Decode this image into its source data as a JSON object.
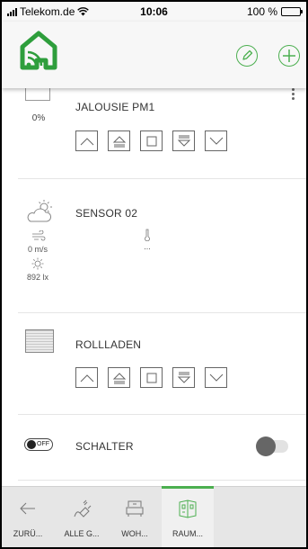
{
  "status_bar": {
    "carrier": "Telekom.de",
    "time": "10:06",
    "battery": "100 %",
    "battery_level": 1.0
  },
  "colors": {
    "accent": "#4caf50",
    "header_bg": "#f7f7f7",
    "nav_bg": "#e6e6e6"
  },
  "header": {
    "logo_icon": "smart-home-logo-icon",
    "edit_icon": "pencil-icon",
    "add_icon": "plus-icon"
  },
  "devices": [
    {
      "title": "JALOUSIE PM1",
      "value": "0%",
      "icon": "jalousie-icon",
      "controls": [
        "up-icon",
        "up-limit-icon",
        "stop-icon",
        "down-limit-icon",
        "down-icon"
      ]
    },
    {
      "title": "SENSOR 02",
      "icon": "weather-icon",
      "wind_value": "0 m/s",
      "temp_value": "...",
      "lux_value": "892 lx"
    },
    {
      "title": "ROLLLADEN",
      "icon": "rollladen-icon",
      "controls": [
        "up-icon",
        "up-limit-icon",
        "stop-icon",
        "down-limit-icon",
        "down-icon"
      ]
    },
    {
      "title": "SCHALTER",
      "icon": "switch-off-icon",
      "badge": "OFF",
      "state": "off"
    }
  ],
  "bottom_nav": [
    {
      "label": "ZURÜ...",
      "icon": "back-arrow-icon",
      "active": false
    },
    {
      "label": "ALLE G...",
      "icon": "plug-icon",
      "active": false
    },
    {
      "label": "WOH...",
      "icon": "sofa-icon",
      "active": false
    },
    {
      "label": "RAUM...",
      "icon": "room-icon",
      "active": true
    }
  ]
}
